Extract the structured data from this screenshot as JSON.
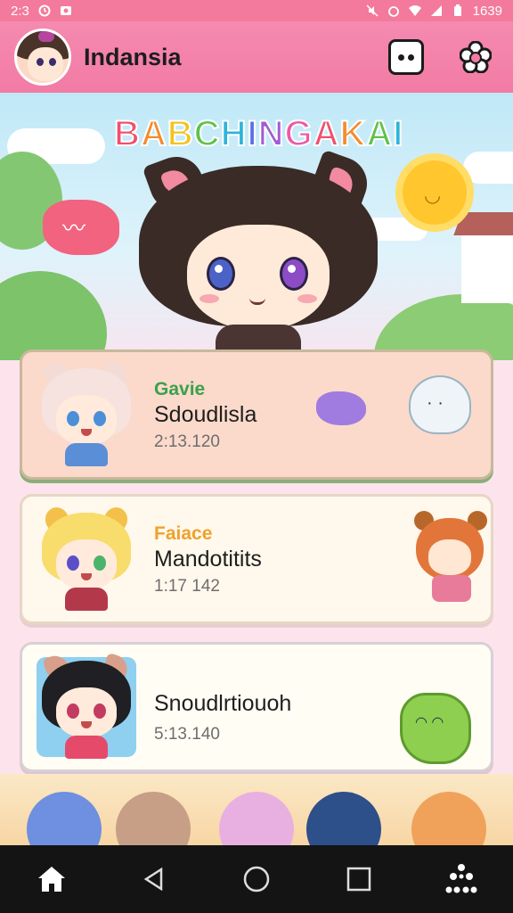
{
  "status_bar": {
    "time": "2:3",
    "clock": "1639"
  },
  "app_bar": {
    "title": "Indansia",
    "chat_icon": "chat-bubble-icon",
    "settings_icon": "flower-icon"
  },
  "hero": {
    "title": "BABCHINGAKAI",
    "title_colors": [
      "#f0506e",
      "#f78a2c",
      "#f4c21b",
      "#5ec24a",
      "#2db4d9",
      "#5a6ee6",
      "#a35bd6",
      "#ec5aa6",
      "#f0506e",
      "#f78a2c",
      "#5ec24a",
      "#2db4d9"
    ]
  },
  "chats": [
    {
      "subtitle": "Gavie",
      "subtitle_color": "#3aa14b",
      "name": "Sdoudlisla",
      "time": "2:13.120"
    },
    {
      "subtitle": "Faiace",
      "subtitle_color": "#f0a12b",
      "name": "Mandotitits",
      "time": "1:17 142"
    },
    {
      "subtitle": "",
      "name": "Snoudlrtiouoh",
      "time": "5:13.140"
    }
  ],
  "nav": {
    "home": "home-icon",
    "back": "back-triangle-icon",
    "recents_home": "circle-home-icon",
    "overview": "square-overview-icon",
    "apps": "apps-grid-icon"
  }
}
